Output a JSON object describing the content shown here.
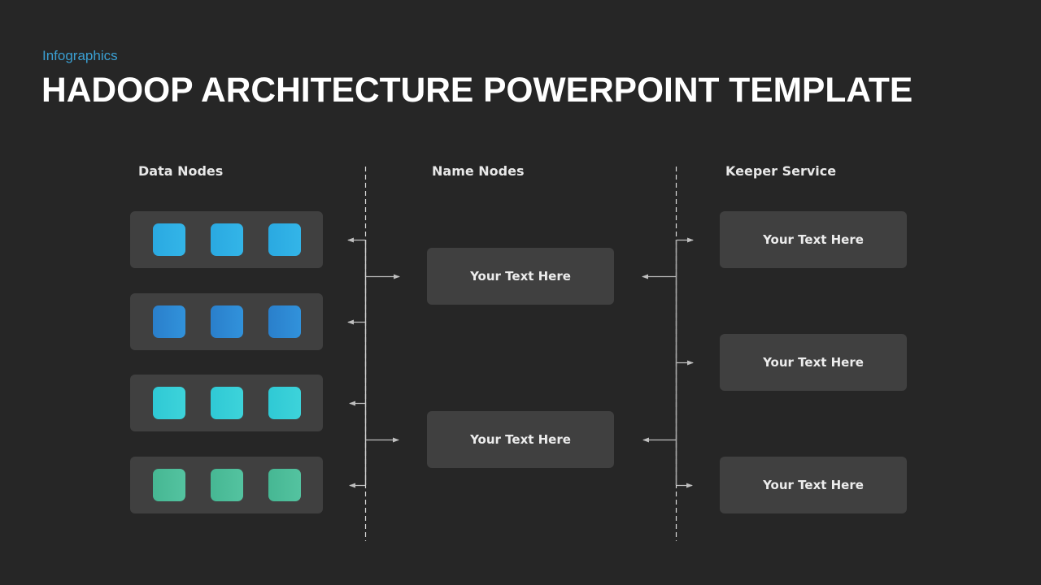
{
  "header": {
    "subtitle": "Infographics",
    "title": "HADOOP ARCHITECTURE POWERPOINT TEMPLATE"
  },
  "colors": {
    "background": "#262626",
    "panel": "#404040",
    "accent": "#3a9fd2",
    "connector": "#bfbfbf"
  },
  "columns": {
    "data_nodes": {
      "label": "Data Nodes",
      "rows": [
        {
          "color": "#2aa9e1",
          "color_light": "#33b5e8",
          "count": 3
        },
        {
          "color": "#2a7fcb",
          "color_light": "#3192db",
          "count": 3
        },
        {
          "color": "#2fc9d5",
          "color_light": "#3dd3da",
          "count": 3
        },
        {
          "color": "#46b793",
          "color_light": "#54c3a0",
          "count": 3
        }
      ]
    },
    "name_nodes": {
      "label": "Name Nodes",
      "boxes": [
        {
          "text": "Your Text Here"
        },
        {
          "text": "Your Text Here"
        }
      ]
    },
    "keeper_service": {
      "label": "Keeper Service",
      "boxes": [
        {
          "text": "Your Text Here"
        },
        {
          "text": "Your Text Here"
        },
        {
          "text": "Your Text Here"
        }
      ]
    }
  }
}
